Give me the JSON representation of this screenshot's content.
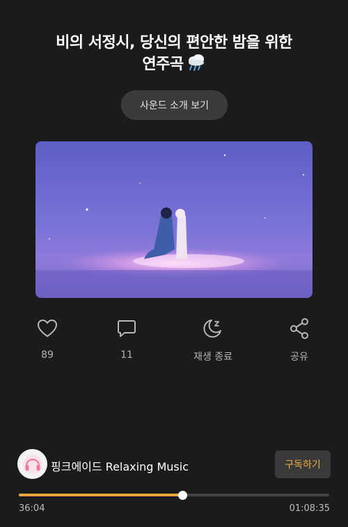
{
  "title": {
    "line1": "비의 서정시, 당신의 편안한 밤을 위한",
    "line2": "연주곡",
    "icon": "cloud-rain-icon"
  },
  "intro_button": "사운드 소개 보기",
  "thumbnail": {
    "icon": "video-thumbnail-couple-on-water"
  },
  "actions": {
    "like": {
      "icon": "heart-icon",
      "label": "89"
    },
    "comment": {
      "icon": "comment-icon",
      "label": "11"
    },
    "sleep_timer": {
      "icon": "moon-zz-icon",
      "label": "재생 종료"
    },
    "share": {
      "icon": "share-icon",
      "label": "공유"
    }
  },
  "channel": {
    "name": "핑크에이드 Relaxing Music",
    "avatar_icon": "headphones-avatar-icon",
    "subscribe_label": "구독하기"
  },
  "player": {
    "current_time": "36:04",
    "total_time": "01:08:35",
    "progress": 0.5258
  },
  "colors": {
    "background": "#1b1b1b",
    "accent": "#f2a53e",
    "subscribe_text": "#f0a93a"
  }
}
